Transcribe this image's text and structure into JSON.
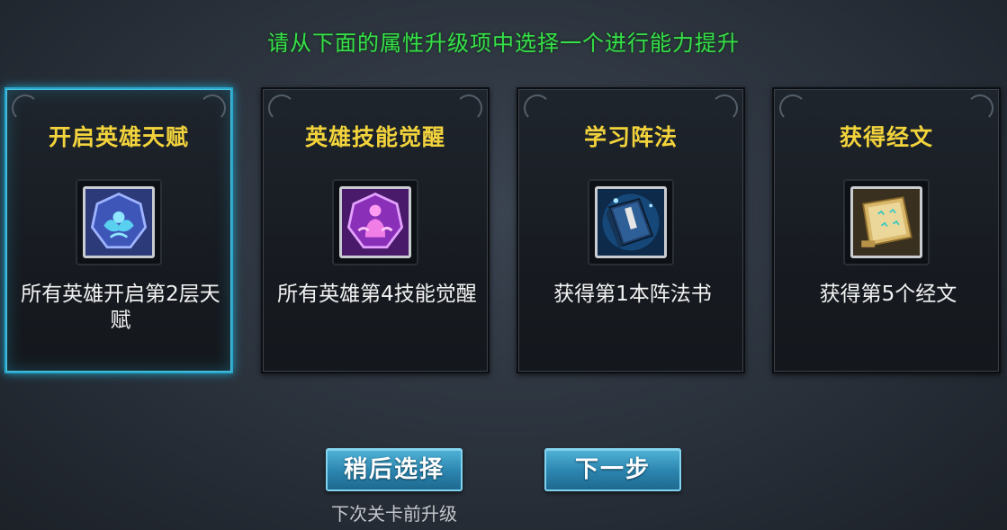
{
  "header": {
    "title": "请从下面的属性升级项中选择一个进行能力提升"
  },
  "cards": [
    {
      "title": "开启英雄天赋",
      "desc": "所有英雄开启第2层天赋",
      "icon": "hero-talent-icon",
      "selected": true
    },
    {
      "title": "英雄技能觉醒",
      "desc": "所有英雄第4技能觉醒",
      "icon": "skill-awaken-icon",
      "selected": false
    },
    {
      "title": "学习阵法",
      "desc": "获得第1本阵法书",
      "icon": "formation-book-icon",
      "selected": false
    },
    {
      "title": "获得经文",
      "desc": "获得第5个经文",
      "icon": "scripture-scroll-icon",
      "selected": false
    }
  ],
  "buttons": {
    "later": "稍后选择",
    "next": "下一步"
  },
  "hint": "下次关卡前升级",
  "colors": {
    "header": "#36e04a",
    "card_title": "#f2d33c",
    "selected_border": "#2aa6c9",
    "button": "#2b84ae"
  }
}
